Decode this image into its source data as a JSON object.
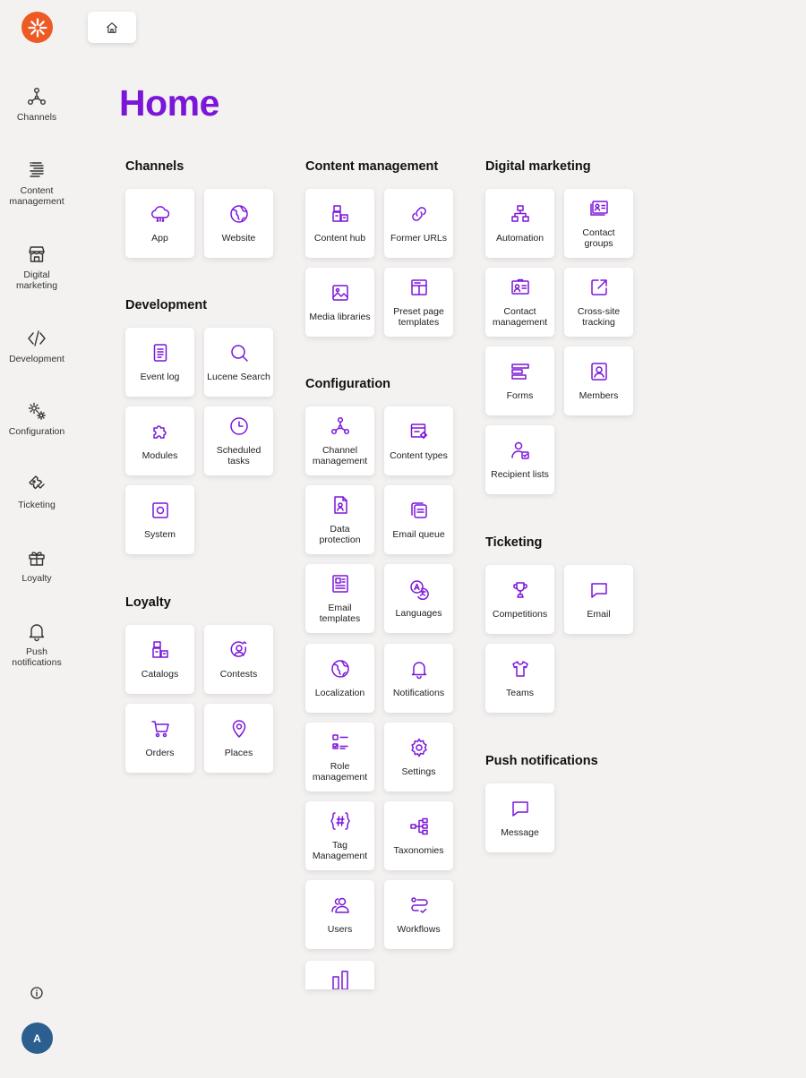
{
  "colors": {
    "accent": "#7b16d9",
    "logo": "#ee5a24",
    "avatar": "#2b5f8f",
    "background": "#f3f2f1"
  },
  "header": {
    "title": "Home"
  },
  "sidebar": {
    "items": [
      {
        "label": "Channels",
        "icon": "channels-icon"
      },
      {
        "label": "Content management",
        "icon": "content-management-icon"
      },
      {
        "label": "Digital marketing",
        "icon": "storefront-icon"
      },
      {
        "label": "Development",
        "icon": "code-icon"
      },
      {
        "label": "Configuration",
        "icon": "gears-icon"
      },
      {
        "label": "Ticketing",
        "icon": "ticket-icon"
      },
      {
        "label": "Loyalty",
        "icon": "gift-icon"
      },
      {
        "label": "Push notifications",
        "icon": "bell-icon"
      }
    ],
    "avatar_initial": "A"
  },
  "sections": {
    "channels": {
      "title": "Channels",
      "tiles": [
        "App",
        "Website"
      ]
    },
    "development": {
      "title": "Development",
      "tiles": [
        "Event log",
        "Lucene Search",
        "Modules",
        "Scheduled tasks",
        "System"
      ]
    },
    "loyalty": {
      "title": "Loyalty",
      "tiles": [
        "Catalogs",
        "Contests",
        "Orders",
        "Places"
      ]
    },
    "content_management": {
      "title": "Content management",
      "tiles": [
        "Content hub",
        "Former URLs",
        "Media libraries",
        "Preset page templates"
      ]
    },
    "configuration": {
      "title": "Configuration",
      "tiles": [
        "Channel management",
        "Content types",
        "Data protection",
        "Email queue",
        "Email templates",
        "Languages",
        "Localization",
        "Notifications",
        "Role management",
        "Settings",
        "Tag Management",
        "Taxonomies",
        "Users",
        "Workflows"
      ]
    },
    "digital_marketing": {
      "title": "Digital marketing",
      "tiles": [
        "Automation",
        "Contact groups",
        "Contact management",
        "Cross-site tracking",
        "Forms",
        "Members",
        "Recipient lists"
      ]
    },
    "ticketing": {
      "title": "Ticketing",
      "tiles": [
        "Competitions",
        "Email",
        "Teams"
      ]
    },
    "push_notifications": {
      "title": "Push notifications",
      "tiles": [
        "Message"
      ]
    }
  }
}
